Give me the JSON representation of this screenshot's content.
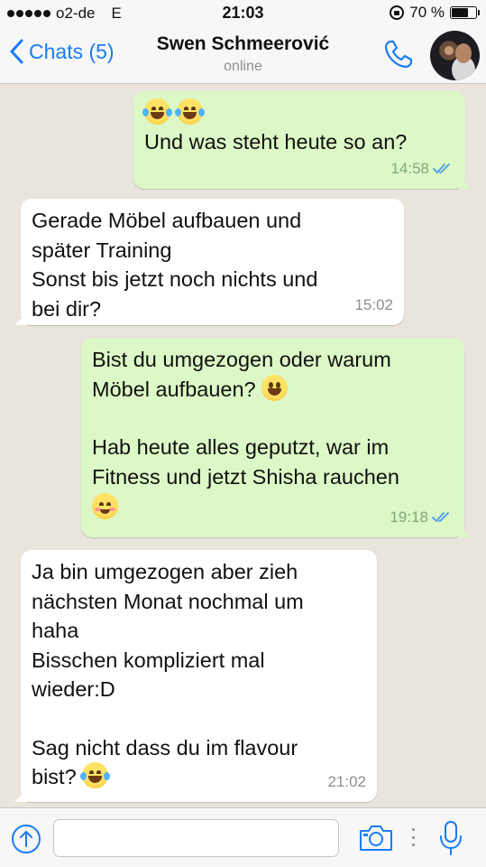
{
  "status_bar": {
    "carrier": "o2-de",
    "network": "E",
    "time": "21:03",
    "battery": "70 %",
    "battery_level": 0.7
  },
  "header": {
    "back_label": "Chats (5)",
    "contact_name": "Swen Schmeerović",
    "contact_status": "online"
  },
  "messages": [
    {
      "direction": "outgoing",
      "text": "Und was steht heute so an?",
      "time": "14:58",
      "read": true
    },
    {
      "direction": "incoming",
      "text": "Gerade Möbel aufbauen und\nspäter Training\nSonst bis jetzt noch nichts und\nbei dir?",
      "time": "15:02"
    },
    {
      "direction": "outgoing",
      "text_1": "Bist du umgezogen oder warum\nMöbel aufbauen?",
      "text_2": "Hab heute alles geputzt, war im\nFitness und jetzt Shisha rauchen",
      "time": "19:18",
      "read": true
    },
    {
      "direction": "incoming",
      "text_1": "Ja bin umgezogen aber zieh\nnächsten Monat nochmal um\nhaha\nBisschen kompliziert mal\nwieder:D",
      "text_2": "Sag nicht dass du im flavour\nbist?",
      "time": "21:02"
    }
  ],
  "input": {
    "placeholder": ""
  },
  "colors": {
    "accent": "#1a7cf5",
    "outgoing_bubble": "#dcf8c6",
    "incoming_bubble": "#ffffff",
    "chat_background": "#e9e4dc",
    "read_ticks": "#4a9ee8"
  },
  "icons": [
    "back-chevron-icon",
    "phone-icon",
    "upload-icon",
    "camera-icon",
    "microphone-icon",
    "double-check-icon",
    "rotation-lock-icon",
    "battery-icon"
  ]
}
